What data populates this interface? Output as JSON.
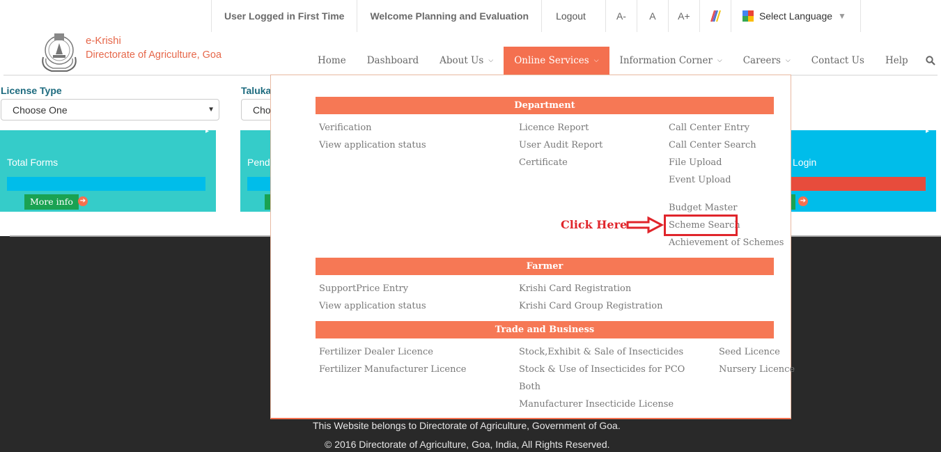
{
  "topbar": {
    "user_status": "User Logged in First Time",
    "welcome": "Welcome Planning and Evaluation",
    "logout": "Logout",
    "font_decrease": "A-",
    "font_normal": "A",
    "font_increase": "A+",
    "language": "Select Language",
    "language_caret": "▼"
  },
  "brand": {
    "title": "e-Krishi",
    "subtitle": "Directorate of Agriculture, Goa"
  },
  "nav": {
    "home": "Home",
    "dashboard": "Dashboard",
    "about": "About Us",
    "online_services": "Online Services",
    "information_corner": "Information Corner",
    "careers": "Careers",
    "contact": "Contact Us",
    "help": "Help",
    "caret": "⌄"
  },
  "filters": {
    "license_type_label": "License Type",
    "license_type_value": "Choose One",
    "taluka_label": "Taluka",
    "taluka_value": "Cho"
  },
  "boxes": {
    "total_forms": "Total Forms",
    "pending": "Pend",
    "login": "Login",
    "more_info": "More info",
    "arrow": "➔",
    "corner": "▸"
  },
  "mega_menu": {
    "department": {
      "title": "Department",
      "col1": [
        "Verification",
        "View application status"
      ],
      "col2": [
        "Licence Report",
        "User Audit Report",
        "Certificate"
      ],
      "col3": [
        "Call Center Entry",
        "Call Center Search",
        "File Upload",
        "Event Upload",
        "Budget Master",
        "Scheme Search",
        "Achievement of Schemes"
      ]
    },
    "farmer": {
      "title": "Farmer",
      "col1": [
        "SupportPrice Entry",
        "View application status"
      ],
      "col2": [
        "Krishi Card Registration",
        "Krishi Card Group Registration"
      ]
    },
    "trade": {
      "title": "Trade and Business",
      "col1": [
        "Fertilizer Dealer Licence",
        "Fertilizer Manufacturer Licence"
      ],
      "col2": [
        "Stock,Exhibit & Sale of Insecticides",
        "Stock & Use of Insecticides for PCO",
        "Both",
        "Manufacturer Insecticide License"
      ],
      "col3": [
        "Seed Licence",
        "Nursery Licence"
      ]
    }
  },
  "annotation": {
    "click_here": "Click Here",
    "color": "#e0252b"
  },
  "footer": {
    "line1": "This Website belongs to Directorate of Agriculture, Government of Goa.",
    "line2": "© 2016 Directorate of Agriculture, Goa, India, All Rights Reserved."
  },
  "colors": {
    "accent": "#f4704f",
    "teal_box": "#35ccc9",
    "cyan_bar": "#00bdea",
    "login_bar": "#e74c3c",
    "more_info_btn": "#1aa252",
    "footer_bg": "#292929",
    "label_teal": "#1c6a7e"
  },
  "icons": {
    "logo": "goa-emblem-logo",
    "accessibility": "color-contrast-icon",
    "translate": "google-translate-icon",
    "search": "search-icon"
  }
}
